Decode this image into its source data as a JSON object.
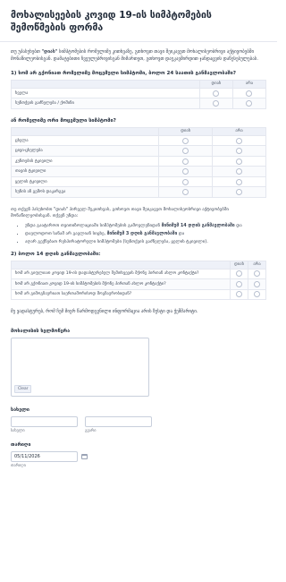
{
  "form": {
    "title": "მოხალისეების კოვიდ 19-ის სიმპტომების შემოწმების ფორმა",
    "intro_prefix": "თუ უპასუხებთ ",
    "intro_bold": "\"დიახ\"",
    "intro_suffix": " სიმპტომების რომელიმე კითხვაზე, გთხოვთ თავი შეიკავეთ მოხალისეობრივი აქტივობებში მონაწილეობისგან. დამატებითი ჩვეულებრივისგან მიმართეთ, გთხოვთ დაუკავშირდით ჯანდაცვის დაწესებულებას."
  },
  "q1": {
    "title": "1) ხომ არ გქონიათ რომელიმე მოცემული სიმპტომი, ბოლო 24 საათის განმავლობაში?",
    "columns": [
      "დიახ",
      "არა"
    ],
    "rows": [
      "ხველა",
      "სუნთქვის გაძნელება / ქოშინი"
    ]
  },
  "q2": {
    "title": "ან რომელიმე ორი მოცემული სიმპტომი?",
    "columns": [
      "დიახ",
      "არა"
    ],
    "rows": [
      "ცხელა",
      "ცივი-ცხელება",
      "კუნთების ტკივილი",
      "თავის ტკივილი",
      "ყელის ტკივილი",
      "სუნის ან გემოს დაკარგვა"
    ]
  },
  "note": {
    "text": "თუ თქვენ პასუხობთ \"დიახ\" პირველ შეკითხვას, გთხოვთ თავი შეიკავეთ მოხალისეობრივი აქტივობებში მონაწილეობისგან. თქვენ უნდა:",
    "bullets": [
      {
        "pre": "უნდა გაატაროთ თვითიზოლაციაში სიმპტომების გამოვლენიდან ",
        "bold": "მინიმუმ 14 დღის განმავლობაში",
        "post": " და"
      },
      {
        "pre": "დაელოდოთ სანამ არ გავლიან სიცხე, ",
        "bold": "მინიმუმ 3 დღის განმავლობაში",
        "post": " და"
      },
      {
        "pre": "აღარ გექნებათ რესპირატორული სიმპტომები (სუნთქვის გაძნელება, ყელის ტკივილი).",
        "bold": "",
        "post": ""
      }
    ]
  },
  "q3": {
    "title": "2) ბოლო 14 დღის განმავლობაში:",
    "columns": [
      "დიახ",
      "არა"
    ],
    "rows": [
      "ხომ არ გიფლიათ კოვიდ 19-ის დადასტურებულ შემთხვევის მქონე პირთან ახლო კონტაქტი?",
      "ხომ არ გქონიათ კოვიდ 19-ის სიმპტომების მქონე პირთან ახლო კონტაქტი?",
      "ხომ არ გიმოგზაურიათ საერთაშორისოდ მოგზაურობიდან?"
    ]
  },
  "closing": "მე ვადასტურებ, რომ ჩემ მიერ წარმოდგენილი ინფორმაცია არის ზუსტი და ჭეშმარიტი.",
  "signature": {
    "label": "მოხალისის ხელმოწერა",
    "clear_label": "Clear"
  },
  "name": {
    "label": "სახელი",
    "first_sublabel": "სახელი",
    "last_sublabel": "გვარი"
  },
  "date": {
    "label": "თარიღი",
    "value": "05/11/2026",
    "sublabel": "თარიღი"
  }
}
